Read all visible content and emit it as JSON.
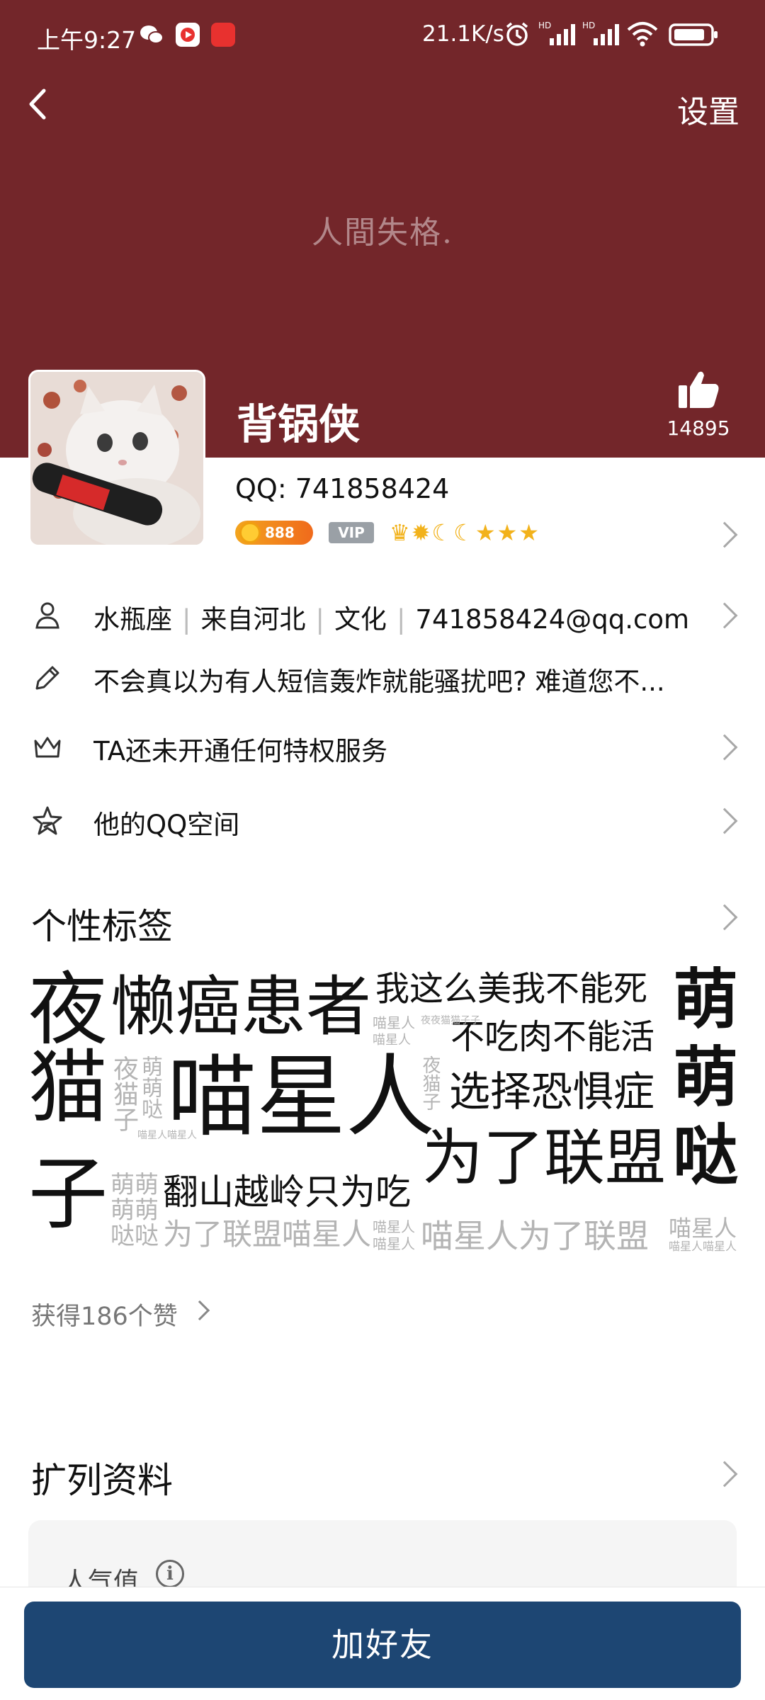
{
  "status_bar": {
    "time": "上午9:27",
    "net_speed": "21.1K/s",
    "hd1": "HD",
    "hd2": "HD"
  },
  "topbar": {
    "settings": "设置"
  },
  "banner": {
    "text": "人間失格."
  },
  "profile": {
    "nickname": "背锅侠",
    "qq_label": "QQ: 741858424",
    "like_count": "14895",
    "coin_badge": "888",
    "vip_badge": "VIP"
  },
  "info": {
    "zodiac": "水瓶座",
    "hometown": "来自河北",
    "industry": "文化",
    "email": "741858424@qq.com",
    "signature": "不会真以为有人短信轰炸就能骚扰吧? 难道您不...",
    "privilege": "TA还未开通任何特权服务",
    "qzone": "他的QQ空间"
  },
  "tags_section": {
    "title": "个性标签",
    "tags": [
      "夜",
      "懒癌患者",
      "我这么美我不能死",
      "萌",
      "喵星人",
      "不吃肉不能活",
      "猫",
      "夜猫子",
      "喵星人",
      "夜猫子",
      "选择恐惧症",
      "萌",
      "萌萌哒",
      "为了联盟",
      "哒",
      "子",
      "萌萌",
      "萌萌",
      "哒哒",
      "翻山越岭只为吃",
      "为了联盟喵星人",
      "喵星人",
      "喵星人",
      "喵星人为了联盟",
      "喵星人",
      "喵星人喵星人",
      "喵星人",
      "夜夜猫猫子子",
      "喵星人喵星人"
    ],
    "likes": "获得186个赞"
  },
  "extra_section": {
    "title": "扩列资料",
    "popularity_label": "人气值"
  },
  "bottom": {
    "add_friend": "加好友"
  },
  "colors": {
    "header_bg": "#73262a",
    "button_bg": "#1d4673"
  }
}
